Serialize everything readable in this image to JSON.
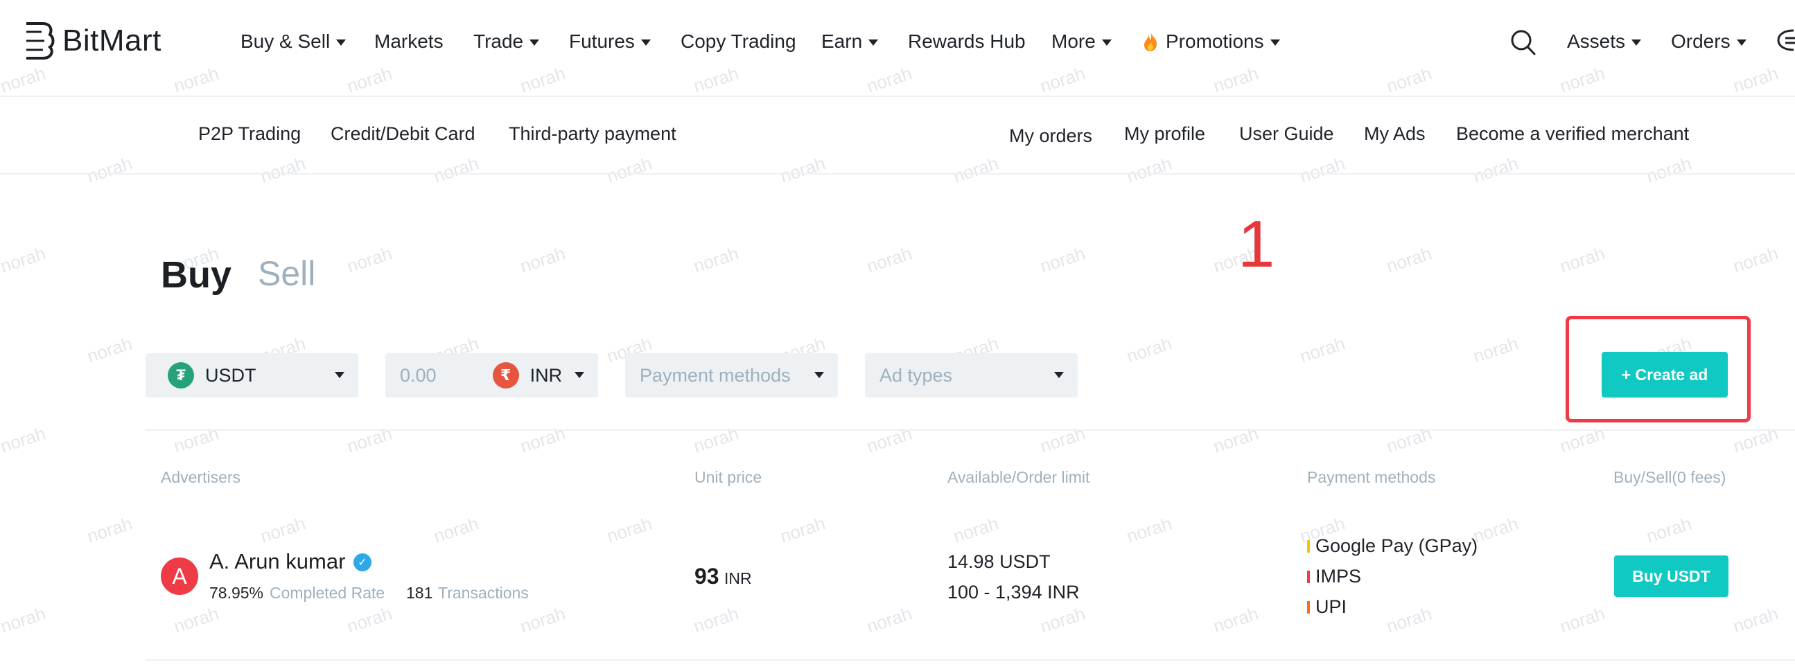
{
  "brand": {
    "name": "BitMart"
  },
  "topnav": {
    "items": [
      {
        "label": "Buy & Sell",
        "dropdown": true
      },
      {
        "label": "Markets",
        "dropdown": false
      },
      {
        "label": "Trade",
        "dropdown": true
      },
      {
        "label": "Futures",
        "dropdown": true
      },
      {
        "label": "Copy Trading",
        "dropdown": false
      },
      {
        "label": "Earn",
        "dropdown": true
      },
      {
        "label": "Rewards Hub",
        "dropdown": false
      },
      {
        "label": "More",
        "dropdown": true
      },
      {
        "label": "Promotions",
        "dropdown": true,
        "icon": "fire-icon"
      }
    ],
    "right": {
      "search_icon": "search-icon",
      "assets_label": "Assets",
      "orders_label": "Orders",
      "chat_icon": "chat-icon"
    }
  },
  "subnav": {
    "left": [
      "P2P Trading",
      "Credit/Debit Card",
      "Third-party payment"
    ],
    "right": [
      "My orders",
      "My profile",
      "User Guide",
      "My Ads",
      "Become a verified merchant"
    ]
  },
  "tabs": {
    "buy": "Buy",
    "sell": "Sell"
  },
  "annotation": {
    "step_number": "1",
    "color": "#e5383b"
  },
  "filters": {
    "coin": {
      "value": "USDT",
      "icon": "tether-icon"
    },
    "amount": {
      "placeholder": "0.00",
      "currency": "INR",
      "currency_icon": "rupee-icon"
    },
    "payment_methods": {
      "placeholder": "Payment methods"
    },
    "ad_types": {
      "placeholder": "Ad types"
    },
    "create_ad_label": "+ Create ad"
  },
  "table": {
    "headers": [
      "Advertisers",
      "Unit price",
      "Available/Order limit",
      "Payment methods",
      "Buy/Sell(0 fees)"
    ],
    "rows": [
      {
        "avatar_letter": "A",
        "name": "A. Arun kumar",
        "verified": true,
        "completed_rate": "78.95%",
        "completed_rate_label": "Completed Rate",
        "transactions": "181",
        "transactions_label": "Transactions",
        "unit_price": "93",
        "price_currency": "INR",
        "available": "14.98 USDT",
        "limit": "100 - 1,394 INR",
        "payment_methods": [
          {
            "name": "Google Pay (GPay)",
            "color": "#f5c400"
          },
          {
            "name": "IMPS",
            "color": "#ef3b45"
          },
          {
            "name": "UPI",
            "color": "#ff6a1a"
          }
        ],
        "action_label": "Buy USDT"
      }
    ]
  },
  "colors": {
    "accent": "#0fc9c2",
    "highlight": "#ef3b45",
    "muted": "#9fb0bd"
  },
  "watermark": "norah"
}
